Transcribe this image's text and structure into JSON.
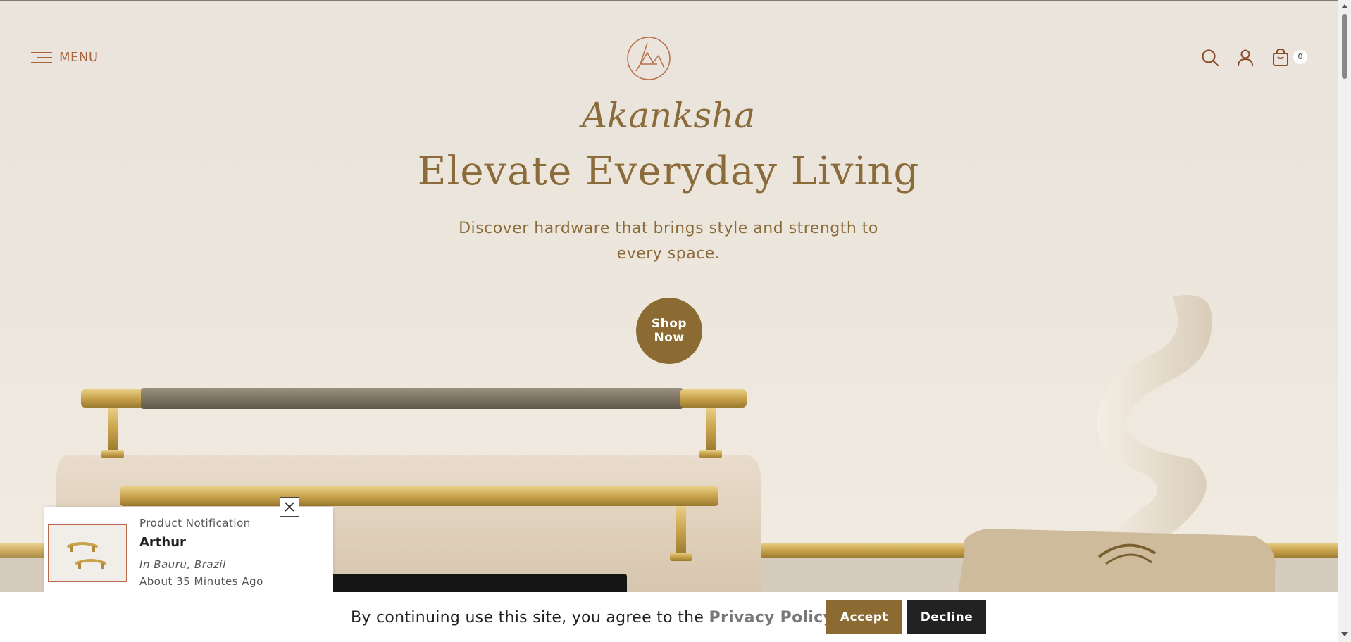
{
  "header": {
    "menu_label": "MENU",
    "menu_icon": "hamburger-menu-icon",
    "logo_icon": "brand-logo-icon",
    "search_icon": "search-icon",
    "account_icon": "user-icon",
    "cart_icon": "cart-icon",
    "cart_count": "0"
  },
  "hero": {
    "brand_script": "Akanksha",
    "headline": "Elevate Everyday Living",
    "subcopy": "Discover hardware that brings style and strength to every space.",
    "cta_label": "Shop Now"
  },
  "notification": {
    "kicker": "Product Notification",
    "name": "Arthur",
    "location": "In Bauru, Brazil",
    "time": "About 35 Minutes Ago",
    "close_icon": "close-icon",
    "thumb_icon": "product-thumbnail-image"
  },
  "cookie_bar": {
    "text": "By continuing use this site, you agree to the",
    "link": "Privacy Policy",
    "accept_label": "Accept",
    "decline_label": "Decline"
  },
  "colors": {
    "accent": "#8b6b32",
    "text_brand": "#8b6b3a",
    "menu": "#a5643c",
    "dark": "#222222"
  }
}
